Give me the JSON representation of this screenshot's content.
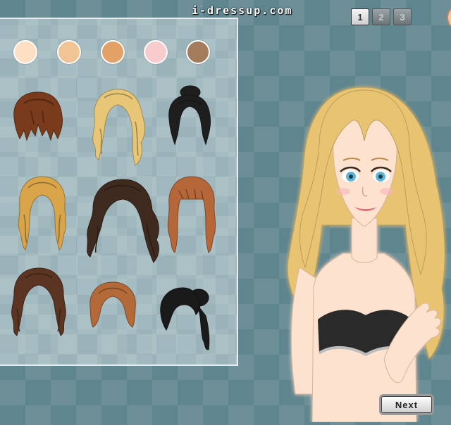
{
  "header": {
    "brand": "i-dressup.com"
  },
  "pager": {
    "pages": [
      "1",
      "2",
      "3"
    ],
    "active_page": "1"
  },
  "skin_tones": [
    "#fde0c4",
    "#f1c495",
    "#e4a165",
    "#f8cccc",
    "#a27c5b"
  ],
  "hairstyles": [
    {
      "name": "auburn-shag-bob",
      "color": "#7a3a1c"
    },
    {
      "name": "blonde-wavy-long",
      "color": "#e7c777"
    },
    {
      "name": "black-updo",
      "color": "#1e1e1e"
    },
    {
      "name": "golden-wavy-mid",
      "color": "#d9a44a"
    },
    {
      "name": "dark-brown-long-layered",
      "color": "#3f2a20"
    },
    {
      "name": "copper-wavy-bangs",
      "color": "#b5673a"
    },
    {
      "name": "brown-wavy-long",
      "color": "#5b3422"
    },
    {
      "name": "copper-bob",
      "color": "#b36a38"
    },
    {
      "name": "black-side-ponytail",
      "color": "#1a1a1a"
    }
  ],
  "model": {
    "hair_color": "#e8c472",
    "skin_color": "#fde3cf",
    "eye_color": "#5fb6d6",
    "top_color": "#2a2a2a"
  },
  "footer": {
    "next_label": "Next"
  }
}
